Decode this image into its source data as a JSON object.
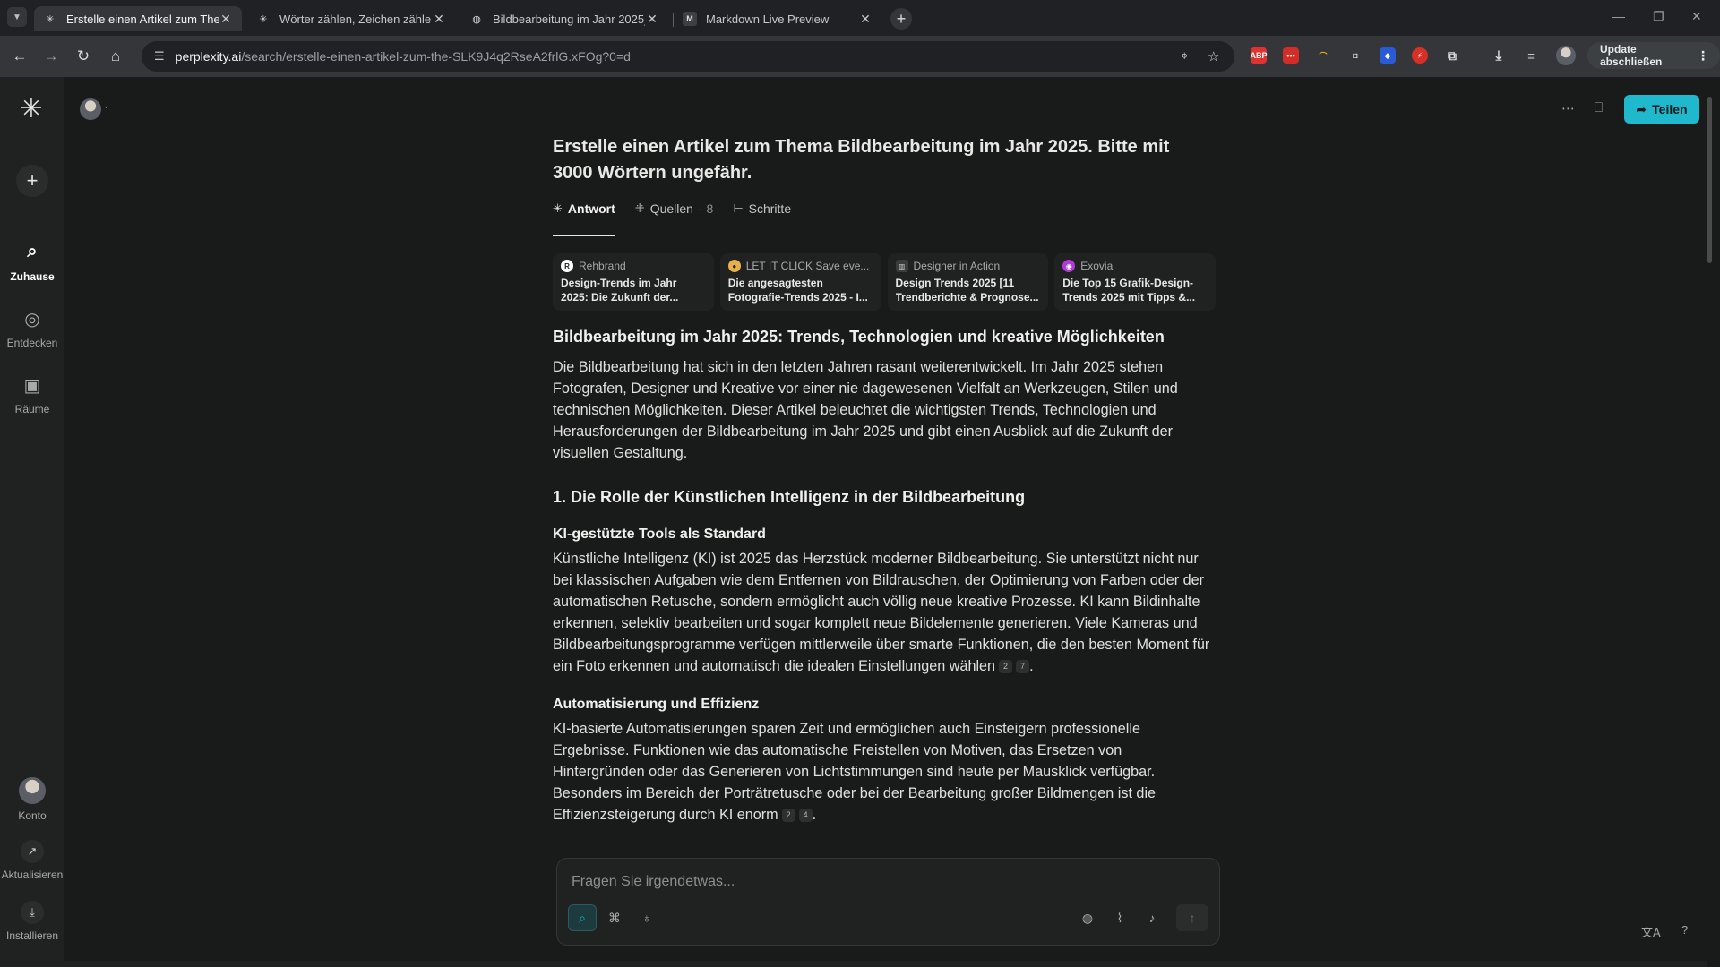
{
  "browser": {
    "tabs": [
      {
        "title": "Erstelle einen Artikel zum Them",
        "favicon": "perplexity-icon",
        "active": true
      },
      {
        "title": "Wörter zählen, Zeichen zählen",
        "favicon": "perplexity-icon",
        "active": false
      },
      {
        "title": "Bildbearbeitung im Jahr 2025_",
        "favicon": "globe-icon",
        "active": false
      },
      {
        "title": "Markdown Live Preview",
        "favicon": "markdown-icon",
        "active": false
      }
    ],
    "url_host": "perplexity.ai",
    "url_path": "/search/erstelle-einen-artikel-zum-the-SLK9J4q2RseA2frlG.xFOg?0=d",
    "update_label": "Update abschließen",
    "extensions": [
      {
        "name": "adblock-icon",
        "text": "ABP",
        "color": "#e0322e"
      },
      {
        "name": "lastpass-icon",
        "text": "•••",
        "color": "#d32d27"
      },
      {
        "name": "rainbow-icon",
        "text": "⌒",
        "color": "#35363a"
      },
      {
        "name": "camera-icon",
        "text": "◘",
        "color": "#35363a"
      },
      {
        "name": "shield-icon",
        "text": "◆",
        "color": "#2a5bd7"
      },
      {
        "name": "flash-icon",
        "text": "⚡",
        "color": "#d93025"
      },
      {
        "name": "puzzle-icon",
        "text": "⧉",
        "color": "#35363a"
      }
    ]
  },
  "sidebar": {
    "items": [
      {
        "label": "Zuhause",
        "icon": "search-icon"
      },
      {
        "label": "Entdecken",
        "icon": "globe-icon"
      },
      {
        "label": "Räume",
        "icon": "spaces-icon"
      }
    ],
    "bottom": [
      {
        "label": "Konto",
        "icon": "avatar"
      },
      {
        "label": "Aktualisieren",
        "icon": "arrow-up-right-icon"
      },
      {
        "label": "Installieren",
        "icon": "download-icon"
      }
    ]
  },
  "header": {
    "share_label": "Teilen"
  },
  "thread": {
    "question": "Erstelle einen Artikel zum Thema Bildbearbeitung im Jahr 2025. Bitte mit 3000 Wörtern ungefähr.",
    "tabs": [
      {
        "label": "Antwort",
        "count": ""
      },
      {
        "label": "Quellen",
        "count": "· 8"
      },
      {
        "label": "Schritte",
        "count": ""
      }
    ],
    "sources": [
      {
        "site": "Rehbrand",
        "title": "Design-Trends im Jahr 2025: Die Zukunft der...",
        "color": "#ffffff",
        "glyph": "R"
      },
      {
        "site": "LET IT CLICK Save eve...",
        "title": "Die angesagtesten Fotografie-Trends 2025 - I...",
        "color": "#e8b04a",
        "glyph": "●"
      },
      {
        "site": "Designer in Action",
        "title": "Design Trends 2025 [11 Trendberichte & Prognose...",
        "color": "#3a3b3b",
        "glyph": "▥"
      },
      {
        "site": "Exovia",
        "title": "Die Top 15 Grafik-Design-Trends 2025 mit Tipps &...",
        "color": "#b03ad6",
        "glyph": "◉"
      }
    ],
    "answer": {
      "h1": "Bildbearbeitung im Jahr 2025: Trends, Technologien und kreative Möglichkeiten",
      "intro": "Die Bildbearbeitung hat sich in den letzten Jahren rasant weiterentwickelt. Im Jahr 2025 stehen Fotografen, Designer und Kreative vor einer nie dagewesenen Vielfalt an Werkzeugen, Stilen und technischen Möglichkeiten. Dieser Artikel beleuchtet die wichtigsten Trends, Technologien und Herausforderungen der Bildbearbeitung im Jahr 2025 und gibt einen Ausblick auf die Zukunft der visuellen Gestaltung.",
      "h2": "1. Die Rolle der Künstlichen Intelligenz in der Bildbearbeitung",
      "s1_title": "KI-gestützte Tools als Standard",
      "s1_text": "Künstliche Intelligenz (KI) ist 2025 das Herzstück moderner Bildbearbeitung. Sie unterstützt nicht nur bei klassischen Aufgaben wie dem Entfernen von Bildrauschen, der Optimierung von Farben oder der automatischen Retusche, sondern ermöglicht auch völlig neue kreative Prozesse. KI kann Bildinhalte erkennen, selektiv bearbeiten und sogar komplett neue Bildelemente generieren. Viele Kameras und Bildbearbeitungsprogramme verfügen mittlerweile über smarte Funktionen, die den besten Moment für ein Foto erkennen und automatisch die idealen Einstellungen wählen",
      "s1_cites": [
        "2",
        "7"
      ],
      "s2_title": "Automatisierung und Effizienz",
      "s2_text": "KI-basierte Automatisierungen sparen Zeit und ermöglichen auch Einsteigern professionelle Ergebnisse. Funktionen wie das automatische Freistellen von Motiven, das Ersetzen von Hintergründen oder das Generieren von Lichtstimmungen sind heute per Mausklick verfügbar. Besonders im Bereich der Porträtretusche oder bei der Bearbeitung großer Bildmengen ist die Effizienzsteigerung durch KI enorm",
      "s2_cites": [
        "2",
        "4"
      ]
    }
  },
  "ask": {
    "placeholder": "Fragen Sie irgendetwas..."
  },
  "colors": {
    "accent": "#20b8cd",
    "background": "#191a1a",
    "sidebar": "#202222"
  }
}
